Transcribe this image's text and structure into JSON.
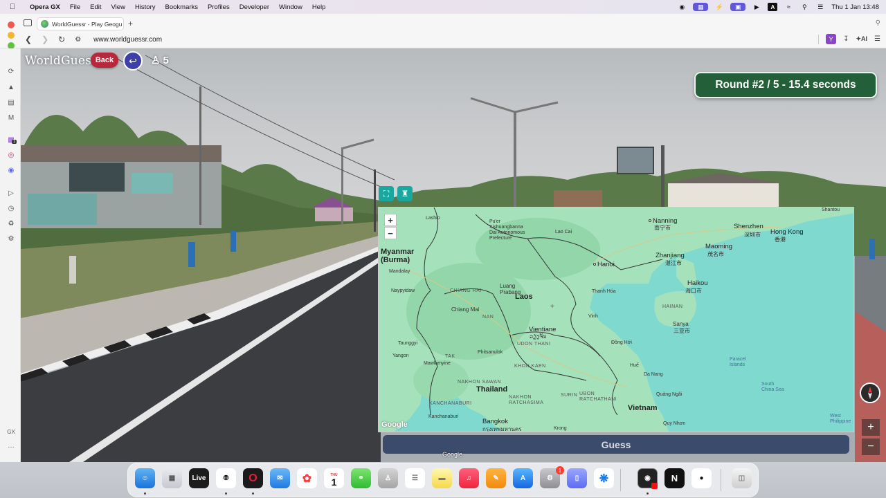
{
  "menubar": {
    "app_name": "Opera GX",
    "items": [
      "File",
      "Edit",
      "View",
      "History",
      "Bookmarks",
      "Profiles",
      "Developer",
      "Window",
      "Help"
    ],
    "clock": "Thu 1 Jan  13:48"
  },
  "browser": {
    "tab_title": "WorldGuessr - Play Geogu",
    "new_tab": "+",
    "url": "www.worldguessr.com",
    "ai_label": "AI",
    "ext_label": "Y"
  },
  "sidebar": {
    "gx_label": "GX",
    "more_label": "…",
    "badge": "1"
  },
  "game": {
    "logo": "WorldGuessr",
    "back_label": "Back",
    "players_count": "5",
    "round_text": "Round #2 / 5 - 15.4 seconds",
    "guess_label": "Guess",
    "google_label": "Google"
  },
  "map": {
    "zoom_in": "+",
    "zoom_out": "−",
    "google_logo": "Google",
    "labels": {
      "myanmar": "Myanmar\n(Burma)",
      "laos": "Laos",
      "thailand": "Thailand",
      "vietnam": "Vietnam",
      "hanoi": "Hanoi",
      "nanning": "Nanning",
      "nanning_cn": "南宁市",
      "shenzhen": "Shenzhen",
      "shenzhen_cn": "深圳市",
      "hongkong": "Hong Kong",
      "hongkong_cn": "香港",
      "zhanjiang": "Zhanjiang",
      "zhanjiang_cn": "湛江市",
      "maoming": "Maoming",
      "maoming_cn": "茂名市",
      "haikou": "Haikou",
      "haikou_cn": "海口市",
      "hainan": "HAINAN",
      "sanya": "Sanya",
      "sanya_cn": "三亚市",
      "vientiane": "Vientiane",
      "vientiane_local": "ວຽງຈັນ",
      "bangkok": "Bangkok",
      "bangkok_local": "กรุงเทพมหานคร",
      "chiang_mai": "Chiang Mai",
      "chiang_rai": "CHIANG RAI",
      "luang_prabang": "Luang\nPrabang",
      "udon_thani": "UDON THANI",
      "khon_kaen": "KHON KAEN",
      "nakhon_sawan": "NAKHON SAWAN",
      "nakhon_ratchasima": "NAKHON\nRATCHASIMA",
      "ubon": "UBON\nRATCHATHANI",
      "surin": "SURIN",
      "kanchanaburi": "KANCHANABURI",
      "tak": "TAK",
      "nan": "NAN",
      "pu_er": "Pu'er\nXishuangbanna\nDai Autonomous\nPrefecture",
      "lao_cai": "Lao Cai",
      "thanh_hoa": "Thanh Hóa",
      "vinh": "Vinh",
      "dong_hoi": "Đồng Hới",
      "hue": "Huế",
      "da_nang": "Da Nang",
      "quang_ngai": "Quảng Ngãi",
      "quy_nhon": "Quy Nhơn",
      "paracel": "Paracel\nIslands",
      "south_china_sea": "South\nChina Sea",
      "naypyidaw": "Naypyidaw",
      "yangon": "Yangon",
      "mawlamyine": "Mawlamyine",
      "phitsanulok": "Phitsanulok",
      "kanchanaburi_city": "Kanchanaburi",
      "krong": "Krong",
      "shantou": "Shantou",
      "west_philippine": "West\nPhilippine",
      "mandalay": "Mandalay",
      "lashio": "Lashio",
      "taunggyi": "Taunggyi"
    }
  },
  "dock": {
    "live_label": "Live",
    "calendar_day": "1",
    "calendar_month": "THU",
    "notif_badge": "1"
  }
}
